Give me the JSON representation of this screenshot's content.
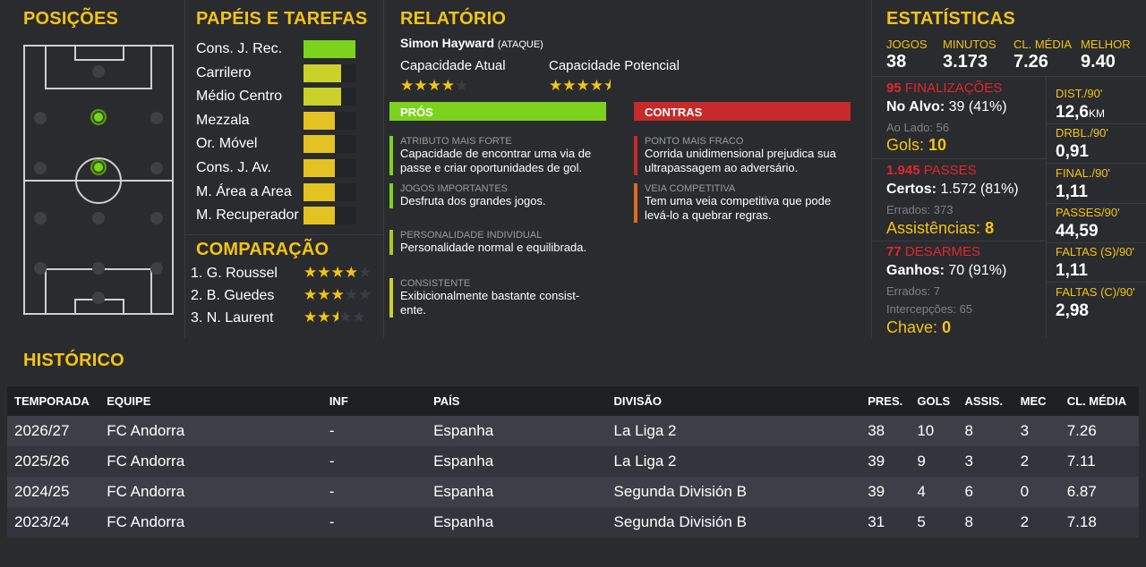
{
  "positions": {
    "title": "POSIÇÕES"
  },
  "roles": {
    "title": "PAPÉIS E TAREFAS",
    "items": [
      {
        "label": "Cons. J. Rec.",
        "level": 1.0,
        "color": "#7cd31e"
      },
      {
        "label": "Carrilero",
        "level": 0.72,
        "color": "#c9d12a"
      },
      {
        "label": "Médio Centro",
        "level": 0.72,
        "color": "#c9d12a"
      },
      {
        "label": "Mezzala",
        "level": 0.6,
        "color": "#e2c322"
      },
      {
        "label": "Or. Móvel",
        "level": 0.6,
        "color": "#e2c322"
      },
      {
        "label": "Cons. J. Av.",
        "level": 0.6,
        "color": "#e2c322"
      },
      {
        "label": "M. Área a Area",
        "level": 0.6,
        "color": "#e2c322"
      },
      {
        "label": "M. Recuperador",
        "level": 0.6,
        "color": "#e2c322"
      }
    ]
  },
  "comparison": {
    "title": "COMPARAÇÃO",
    "items": [
      {
        "label": "1. G. Roussel",
        "stars": 4
      },
      {
        "label": "2. B. Guedes",
        "stars": 3
      },
      {
        "label": "3. N. Laurent",
        "stars": 2.5
      }
    ]
  },
  "report": {
    "title": "RELATÓRIO",
    "player_name": "Simon Hayward",
    "player_role": "(ATAQUE)",
    "current_ability_label": "Capacidade Atual",
    "current_ability_stars": 4,
    "potential_ability_label": "Capacidade Potencial",
    "potential_ability_stars": 4.5,
    "pros_label": "PRÓS",
    "cons_label": "CONTRAS",
    "pros": [
      {
        "title": "ATRIBUTO MAIS FORTE",
        "text": "Capacidade de encontrar uma via de passe e criar oportunidades de gol."
      },
      {
        "title": "JOGOS IMPORTANTES",
        "text": "Desfruta dos grandes jogos."
      },
      {
        "title": "PERSONALIDADE INDIVIDUAL",
        "text": "Personalidade normal e equilibrada."
      },
      {
        "title": "CONSISTENTE",
        "text": "Exibicionalmente bastante consist-ente."
      }
    ],
    "cons": [
      {
        "title": "PONTO MAIS FRACO",
        "text": "Corrida unidimensional prejudica sua ultrapassagem ao adversário."
      },
      {
        "title": "VEIA COMPETITIVA",
        "text": "Tem uma veia competitiva que pode levá-lo a quebrar regras."
      }
    ]
  },
  "stats": {
    "title": "ESTATÍSTICAS",
    "top": [
      {
        "label": "JOGOS",
        "value": "38"
      },
      {
        "label": "MINUTOS",
        "value": "3.173"
      },
      {
        "label": "CL. MÉDIA",
        "value": "7.26"
      },
      {
        "label": "MELHOR",
        "value": "9.40"
      }
    ],
    "shots": {
      "count": "95",
      "label": "FINALIZAÇÕES",
      "on_target_label": "No Alvo:",
      "on_target": "39 (41%)",
      "off_label": "Ao Lado:",
      "off": "56",
      "goals_label": "Gols:",
      "goals": "10"
    },
    "passes": {
      "count": "1.945",
      "label": "PASSES",
      "completed_label": "Certos:",
      "completed": "1.572 (81%)",
      "missed_label": "Errados:",
      "missed": "373",
      "assists_label": "Assistências:",
      "assists": "8"
    },
    "tackles": {
      "count": "77",
      "label": "DESARMES",
      "won_label": "Ganhos:",
      "won": "70 (91%)",
      "lost_label": "Errados:",
      "lost": "7",
      "interceptions_label": "Intercepções:",
      "interceptions": "65",
      "key_label": "Chave:",
      "key": "0"
    },
    "per90": [
      {
        "label": "DIST./90'",
        "value": "12,6",
        "unit": "KM"
      },
      {
        "label": "DRBL./90'",
        "value": "0,91",
        "unit": ""
      },
      {
        "label": "FINAL./90'",
        "value": "1,11",
        "unit": ""
      },
      {
        "label": "PASSES/90'",
        "value": "44,59",
        "unit": ""
      },
      {
        "label": "FALTAS (S)/90'",
        "value": "1,11",
        "unit": ""
      },
      {
        "label": "FALTAS (C)/90'",
        "value": "2,98",
        "unit": ""
      }
    ]
  },
  "history": {
    "title": "HISTÓRICO",
    "columns": [
      "TEMPORADA",
      "EQUIPE",
      "INF",
      "PAÍS",
      "DIVISÃO",
      "PRES.",
      "GOLS",
      "ASSIS.",
      "MEC",
      "CL. MÉDIA"
    ],
    "rows": [
      [
        "2026/27",
        "FC Andorra",
        "-",
        "Espanha",
        "La Liga 2",
        "38",
        "10",
        "8",
        "3",
        "7.26"
      ],
      [
        "2025/26",
        "FC Andorra",
        "-",
        "Espanha",
        "La Liga 2",
        "39",
        "9",
        "3",
        "2",
        "7.11"
      ],
      [
        "2024/25",
        "FC Andorra",
        "-",
        "Espanha",
        "Segunda División B",
        "39",
        "4",
        "6",
        "0",
        "6.87"
      ],
      [
        "2023/24",
        "FC Andorra",
        "-",
        "Espanha",
        "Segunda División B",
        "31",
        "5",
        "8",
        "2",
        "7.18"
      ]
    ]
  }
}
